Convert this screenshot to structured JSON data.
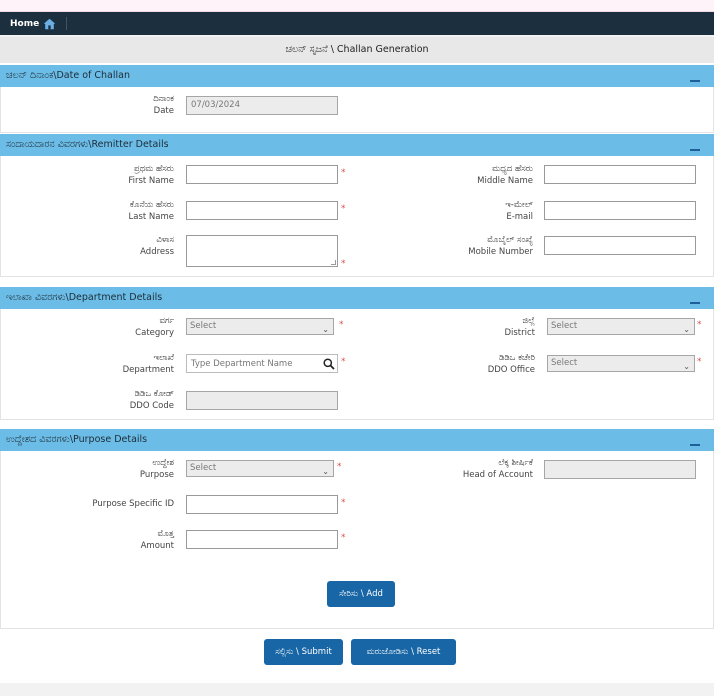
{
  "nav": {
    "home_label": "Home"
  },
  "page_title": "ಚಲನ್ ಸೃಜನೆ \\ Challan Generation",
  "sections": {
    "date": {
      "title": "ಚಲನ್ ದಿನಾಂಕ\\Date of Challan"
    },
    "remitter": {
      "title": "ಸಂದಾಯದಾರನ ವಿವರಗಳು\\Remitter Details"
    },
    "department": {
      "title": "ಇಲಾಖಾ ವಿವರಗಳು\\Department Details"
    },
    "purpose": {
      "title": "ಉದ್ದೇಶದ ವಿವರಗಳು\\Purpose Details"
    }
  },
  "fields": {
    "date": {
      "kn": "ದಿನಾಂಕ",
      "en": "Date",
      "value": "07/03/2024"
    },
    "first_name": {
      "kn": "ಪ್ರಥಮ ಹೆಸರು",
      "en": "First Name",
      "value": ""
    },
    "middle_name": {
      "kn": "ಮಧ್ಯದ ಹೆಸರು",
      "en": "Middle Name",
      "value": ""
    },
    "last_name": {
      "kn": "ಕೊನೆಯ ಹೆಸರು",
      "en": "Last Name",
      "value": ""
    },
    "email": {
      "kn": "ಇ-ಮೇಲ್",
      "en": "E-mail",
      "value": ""
    },
    "address": {
      "kn": "ವಿಳಾಸ",
      "en": "Address",
      "value": ""
    },
    "mobile": {
      "kn": "ಮೊಬೈಲ್ ಸಂಖ್ಯೆ",
      "en": "Mobile Number",
      "value": ""
    },
    "category": {
      "kn": "ವರ್ಗ",
      "en": "Category",
      "value": "Select"
    },
    "district": {
      "kn": "ಜಿಲ್ಲೆ",
      "en": "District",
      "value": "Select"
    },
    "department": {
      "kn": "ಇಲಾಖೆ",
      "en": "Department",
      "placeholder": "Type Department Name"
    },
    "ddo_office": {
      "kn": "ಡಿಡಿಒ ಕಚೇರಿ",
      "en": "DDO Office",
      "value": "Select"
    },
    "ddo_code": {
      "kn": "ಡಿಡಿಒ ಕೋಡ್",
      "en": "DDO Code",
      "value": ""
    },
    "purpose": {
      "kn": "ಉದ್ದೇಶ",
      "en": "Purpose",
      "value": "Select"
    },
    "head_of_account": {
      "kn": "ಲೆಕ್ಕ ಶೀರ್ಷಿಕೆ",
      "en": "Head of Account",
      "value": ""
    },
    "purpose_specific_id": {
      "en": "Purpose Specific ID",
      "value": ""
    },
    "amount": {
      "kn": "ಮೊತ್ತ",
      "en": "Amount",
      "value": ""
    }
  },
  "required_mark": "*",
  "buttons": {
    "add": "ಸೇರಿಸು \\ Add",
    "submit": "ಸಲ್ಲಿಸು \\ Submit",
    "reset": "ಮರುಜೋಡಿಸು \\ Reset"
  },
  "colors": {
    "navbar": "#1b2f3e",
    "section_header": "#6bbde7",
    "button": "#1866a5",
    "required": "#d9534f"
  },
  "icons": {
    "home": "home-icon",
    "search": "search-icon",
    "collapse": "minus-icon",
    "dropdown": "chevron-down-icon"
  }
}
